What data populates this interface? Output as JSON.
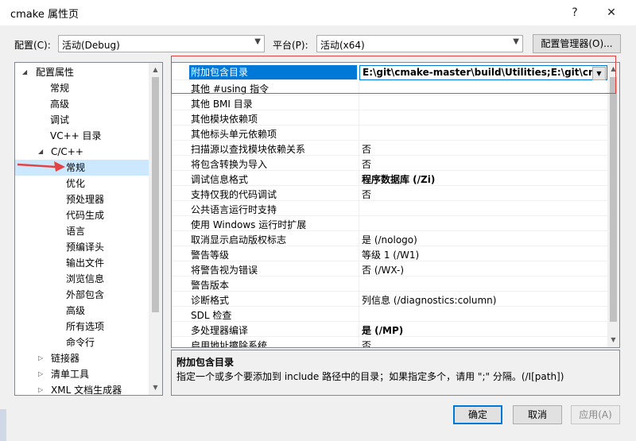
{
  "window": {
    "title": "cmake 属性页",
    "help_btn": "?",
    "close_btn": "✕"
  },
  "toolbar": {
    "config_label": "配置(C):",
    "config_value": "活动(Debug)",
    "platform_label": "平台(P):",
    "platform_value": "活动(x64)",
    "config_manager_label": "配置管理器(O)..."
  },
  "tree": {
    "items": [
      {
        "label": "配置属性"
      },
      {
        "label": "常规"
      },
      {
        "label": "高级"
      },
      {
        "label": "调试"
      },
      {
        "label": "VC++ 目录"
      },
      {
        "label": "C/C++"
      },
      {
        "label": "常规"
      },
      {
        "label": "优化"
      },
      {
        "label": "预处理器"
      },
      {
        "label": "代码生成"
      },
      {
        "label": "语言"
      },
      {
        "label": "预编译头"
      },
      {
        "label": "输出文件"
      },
      {
        "label": "浏览信息"
      },
      {
        "label": "外部包含"
      },
      {
        "label": "高级"
      },
      {
        "label": "所有选项"
      },
      {
        "label": "命令行"
      },
      {
        "label": "链接器"
      },
      {
        "label": "清单工具"
      },
      {
        "label": "XML 文档生成器"
      }
    ]
  },
  "grid": {
    "rows": [
      {
        "name": "附加包含目录",
        "value": "E:\\git\\cmake-master\\build\\Utilities;E:\\git\\cmake"
      },
      {
        "name": "其他 #using 指令",
        "value": ""
      },
      {
        "name": "其他 BMI 目录",
        "value": ""
      },
      {
        "name": "其他模块依赖项",
        "value": ""
      },
      {
        "name": "其他标头单元依赖项",
        "value": ""
      },
      {
        "name": "扫描源以查找模块依赖关系",
        "value": "否"
      },
      {
        "name": "将包含转换为导入",
        "value": "否"
      },
      {
        "name": "调试信息格式",
        "value": "程序数据库 (/Zi)"
      },
      {
        "name": "支持仅我的代码调试",
        "value": "否"
      },
      {
        "name": "公共语言运行时支持",
        "value": ""
      },
      {
        "name": "使用 Windows 运行时扩展",
        "value": ""
      },
      {
        "name": "取消显示启动版权标志",
        "value": "是 (/nologo)"
      },
      {
        "name": "警告等级",
        "value": "等级 1 (/W1)"
      },
      {
        "name": "将警告视为错误",
        "value": "否 (/WX-)"
      },
      {
        "name": "警告版本",
        "value": ""
      },
      {
        "name": "诊断格式",
        "value": "列信息 (/diagnostics:column)"
      },
      {
        "name": "SDL 检查",
        "value": ""
      },
      {
        "name": "多处理器编译",
        "value": "是 (/MP)"
      },
      {
        "name": "启用地址擦除系统",
        "value": "否"
      }
    ]
  },
  "description": {
    "title": "附加包含目录",
    "text": "指定一个或多个要添加到 include 路径中的目录；如果指定多个，请用 \";\" 分隔。(/I[path])"
  },
  "footer": {
    "ok": "确定",
    "cancel": "取消",
    "apply": "应用(A)"
  },
  "colors": {
    "selection": "#0078d7",
    "tree_selection": "#cce8ff",
    "annotation": "#e24444"
  }
}
